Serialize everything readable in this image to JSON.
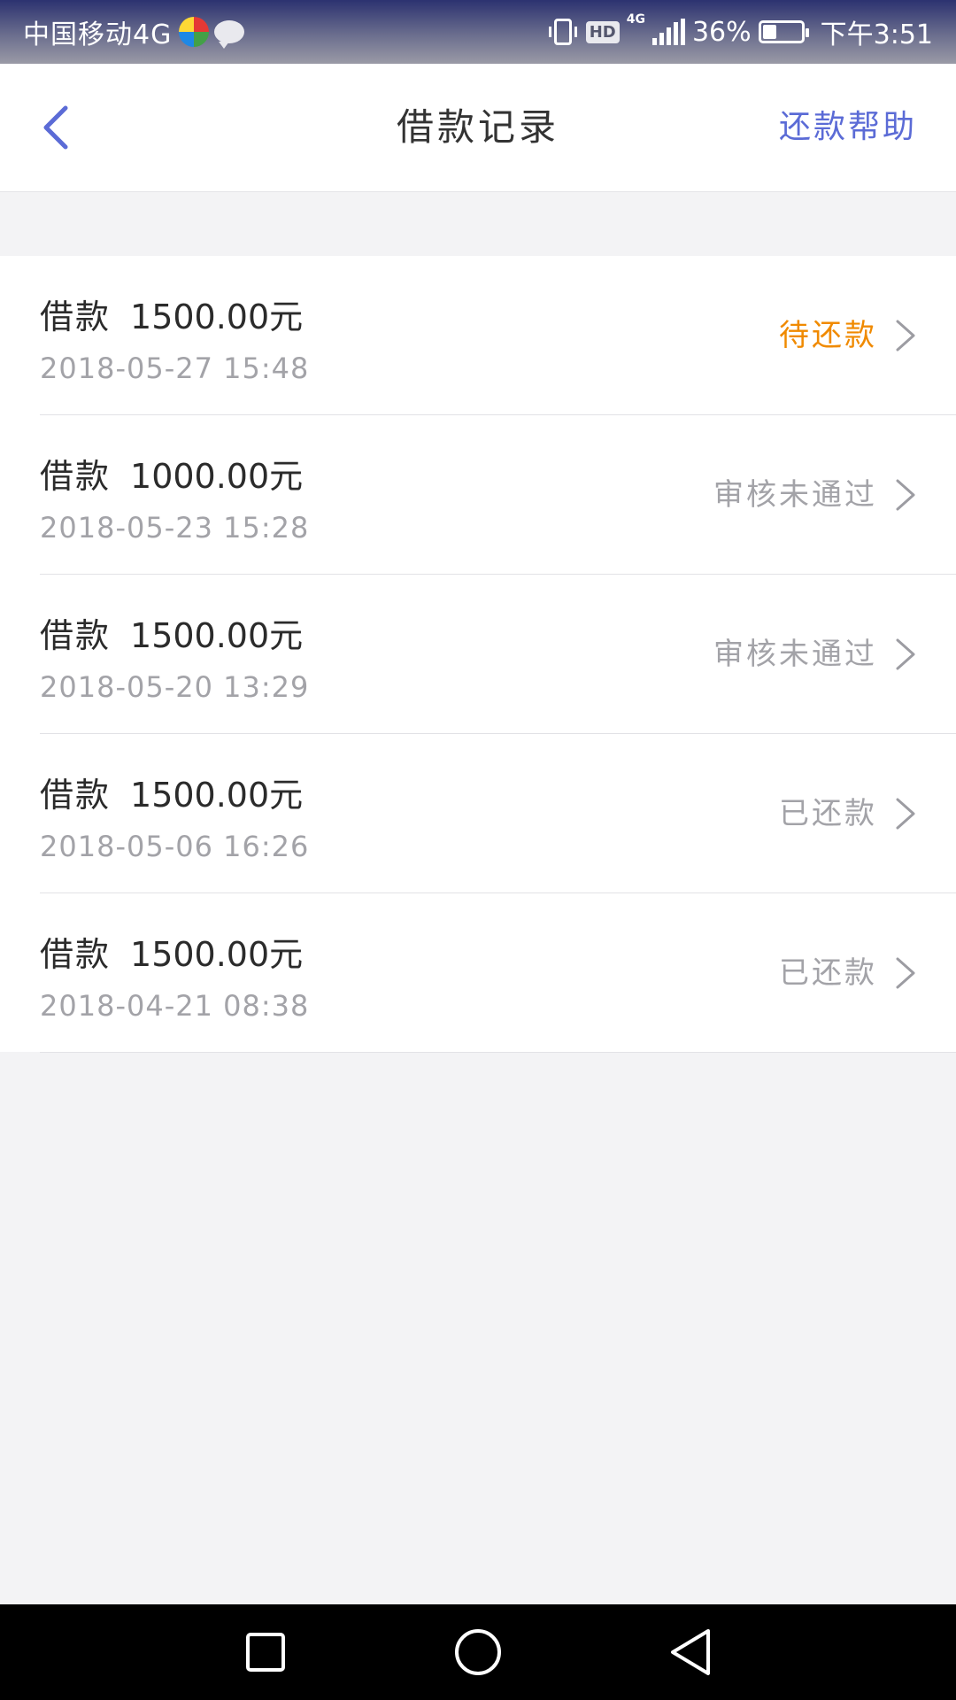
{
  "status_bar": {
    "carrier": "中国移动4G",
    "network_type": "4G",
    "battery_percent": "36%",
    "battery_level": 0.36,
    "time": "下午3:51",
    "hd_label": "HD",
    "icons": [
      "app-badge-icon",
      "chat-icon",
      "vibrate-icon",
      "signal-icon",
      "battery-icon"
    ]
  },
  "header": {
    "title": "借款记录",
    "help_link": "还款帮助",
    "back_icon": "chevron-left-icon",
    "accent_color": "#5b6bd6"
  },
  "records": [
    {
      "label": "借款",
      "amount": "1500.00元",
      "date": "2018-05-27  15:48",
      "status": "待还款",
      "status_color": "#f08a00"
    },
    {
      "label": "借款",
      "amount": "1000.00元",
      "date": "2018-05-23  15:28",
      "status": "审核未通过",
      "status_color": "#a3a3a8"
    },
    {
      "label": "借款",
      "amount": "1500.00元",
      "date": "2018-05-20  13:29",
      "status": "审核未通过",
      "status_color": "#a3a3a8"
    },
    {
      "label": "借款",
      "amount": "1500.00元",
      "date": "2018-05-06  16:26",
      "status": "已还款",
      "status_color": "#a3a3a8"
    },
    {
      "label": "借款",
      "amount": "1500.00元",
      "date": "2018-04-21  08:38",
      "status": "已还款",
      "status_color": "#a3a3a8"
    }
  ],
  "system_nav": {
    "icons": [
      "recent-apps-icon",
      "home-icon",
      "back-triangle-icon"
    ]
  }
}
